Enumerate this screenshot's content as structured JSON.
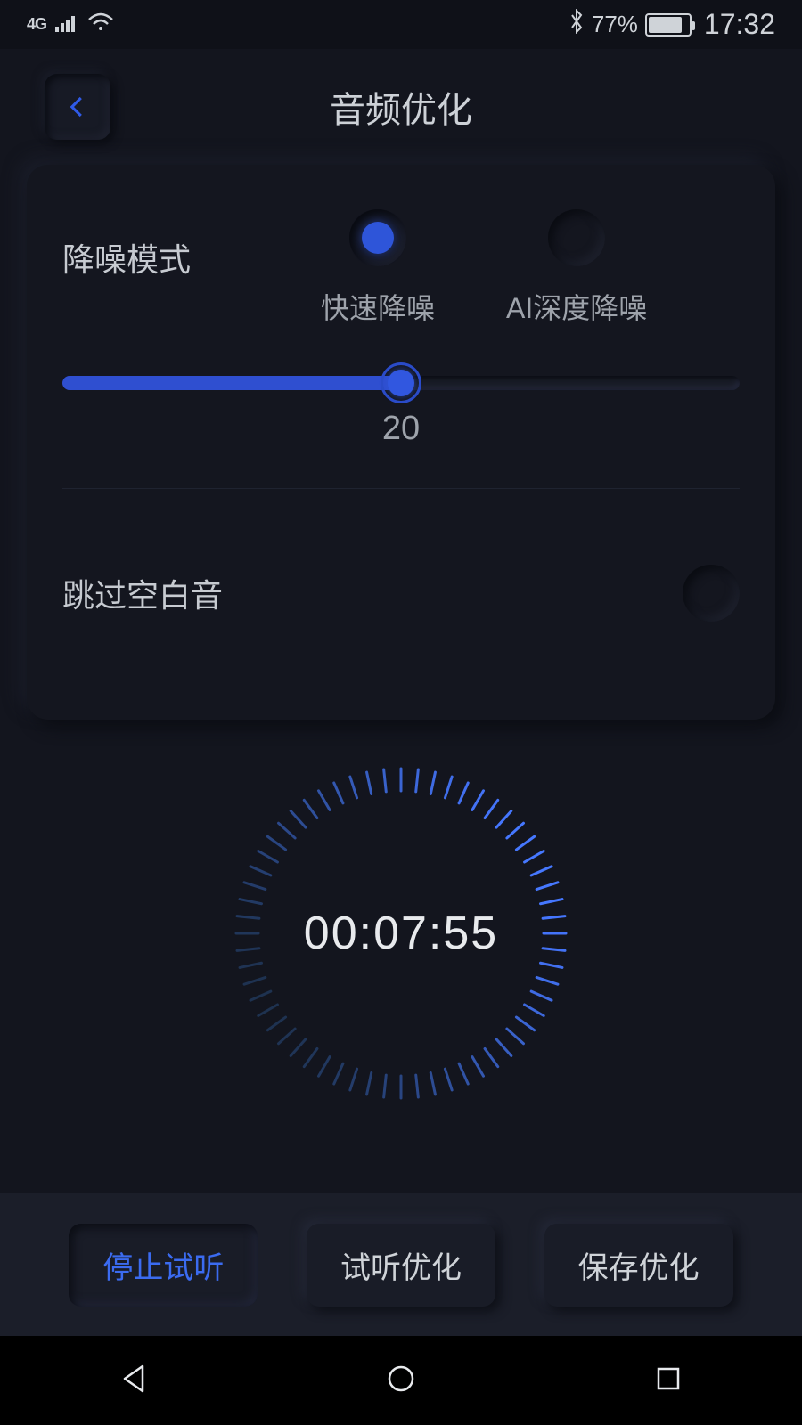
{
  "status": {
    "network": "4G",
    "battery_pct": "77%",
    "time": "17:32"
  },
  "header": {
    "title": "音频优化"
  },
  "denoise": {
    "label": "降噪模式",
    "options": {
      "fast": "快速降噪",
      "ai": "AI深度降噪"
    },
    "selected": "fast",
    "slider_value": "20",
    "slider_pct": 50
  },
  "skip_silence": {
    "label": "跳过空白音",
    "on": false
  },
  "timer": {
    "display": "00:07:55"
  },
  "actions": {
    "stop_preview": "停止试听",
    "preview_optimize": "试听优化",
    "save_optimize": "保存优化"
  }
}
